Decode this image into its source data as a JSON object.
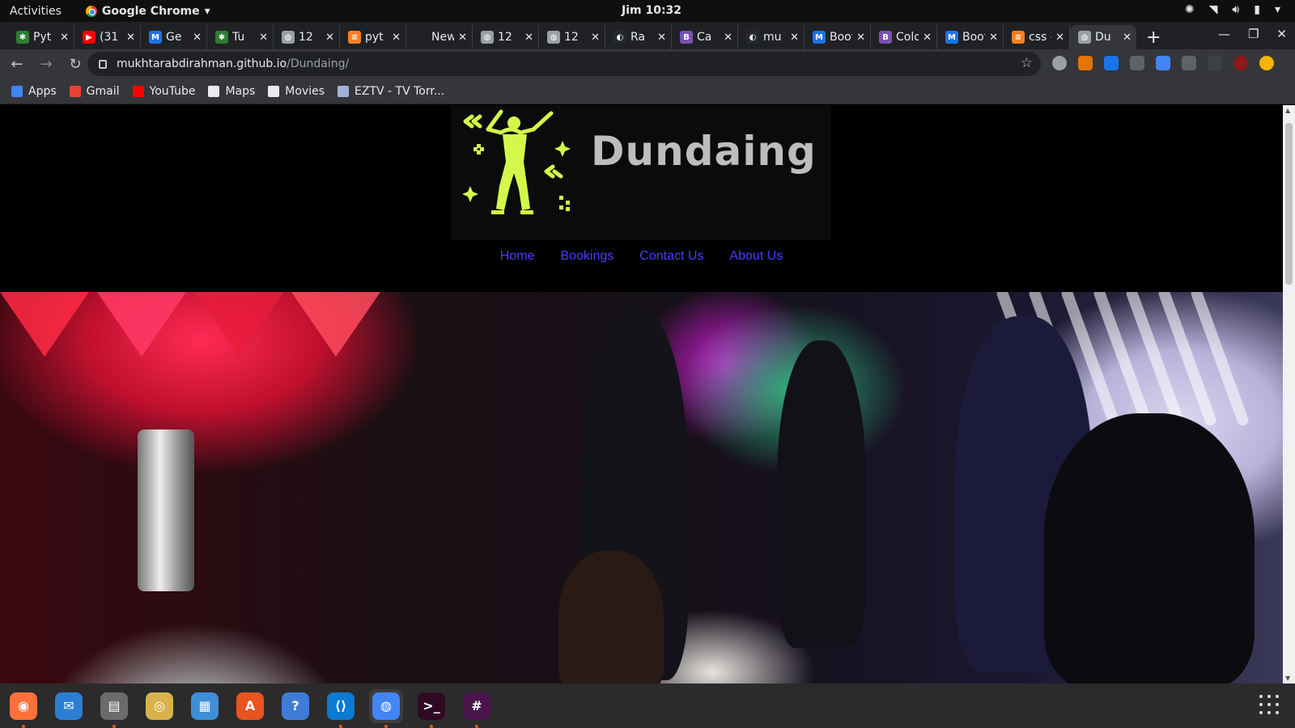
{
  "system": {
    "activities": "Activities",
    "app_name": "Google Chrome",
    "clock": "Jim 10:32"
  },
  "tabs": [
    {
      "title": "Pyt",
      "icon": "spider-icon",
      "color": "#2e7d32"
    },
    {
      "title": "(31",
      "icon": "youtube-icon",
      "color": "#ff0000"
    },
    {
      "title": "Ge",
      "icon": "mdn-icon",
      "color": "#1a73e8"
    },
    {
      "title": "Tu",
      "icon": "spider-icon",
      "color": "#2e7d32"
    },
    {
      "title": "12",
      "icon": "globe-icon",
      "color": "#9aa0a6"
    },
    {
      "title": "pyt",
      "icon": "stackoverflow-icon",
      "color": "#f48024"
    },
    {
      "title": "New T",
      "icon": "",
      "color": "#202124"
    },
    {
      "title": "12",
      "icon": "globe-icon",
      "color": "#9aa0a6"
    },
    {
      "title": "12",
      "icon": "globe-icon",
      "color": "#9aa0a6"
    },
    {
      "title": "Ra",
      "icon": "github-icon",
      "color": "#24292e"
    },
    {
      "title": "Ca",
      "icon": "bootstrap-icon",
      "color": "#7952b3"
    },
    {
      "title": "mu",
      "icon": "github-icon",
      "color": "#24292e"
    },
    {
      "title": "Boots",
      "icon": "mdn-icon",
      "color": "#1a73e8"
    },
    {
      "title": "Colors",
      "icon": "bootstrap-icon",
      "color": "#7952b3"
    },
    {
      "title": "Boots",
      "icon": "mdn-icon",
      "color": "#1a73e8"
    },
    {
      "title": "css - B",
      "icon": "stackoverflow-icon",
      "color": "#f48024"
    },
    {
      "title": "Du",
      "icon": "globe-icon",
      "color": "#9aa0a6",
      "active": true
    }
  ],
  "omnibox": {
    "host": "mukhtarabdirahman.github.io",
    "path": "/Dundaing/"
  },
  "bookmarks": [
    {
      "label": "Apps",
      "icon": "apps-grid-icon",
      "color": "#4285f4"
    },
    {
      "label": "Gmail",
      "icon": "gmail-icon",
      "color": "#ea4335"
    },
    {
      "label": "YouTube",
      "icon": "youtube-icon",
      "color": "#ff0000"
    },
    {
      "label": "Maps",
      "icon": "globe-icon",
      "color": "#e8eaed"
    },
    {
      "label": "Movies",
      "icon": "globe-icon",
      "color": "#e8eaed"
    },
    {
      "label": "EZTV - TV Torr...",
      "icon": "eztv-icon",
      "color": "#9fb3d9"
    }
  ],
  "site": {
    "logo_text": "Dundaing",
    "logo_color": "#d4f84a",
    "nav": [
      {
        "label": "Home"
      },
      {
        "label": "Bookings"
      },
      {
        "label": "Contact Us"
      },
      {
        "label": "About Us"
      }
    ],
    "nav_color": "#4a3cff"
  },
  "dock": [
    {
      "name": "firefox",
      "icon": "firefox-icon",
      "running": true
    },
    {
      "name": "thunderbird",
      "icon": "thunderbird-icon",
      "running": false
    },
    {
      "name": "files",
      "icon": "files-icon",
      "running": true
    },
    {
      "name": "rhythmbox",
      "icon": "rhythmbox-icon",
      "running": false
    },
    {
      "name": "libreoffice-writer",
      "icon": "writer-icon",
      "running": false
    },
    {
      "name": "software",
      "icon": "software-center-icon",
      "running": false
    },
    {
      "name": "help",
      "icon": "help-icon",
      "running": false
    },
    {
      "name": "vscode",
      "icon": "vscode-icon",
      "running": true
    },
    {
      "name": "chrome",
      "icon": "chrome-icon",
      "running": true,
      "active": true
    },
    {
      "name": "terminal",
      "icon": "terminal-icon",
      "running": true
    },
    {
      "name": "slack",
      "icon": "slack-icon",
      "running": true
    }
  ]
}
